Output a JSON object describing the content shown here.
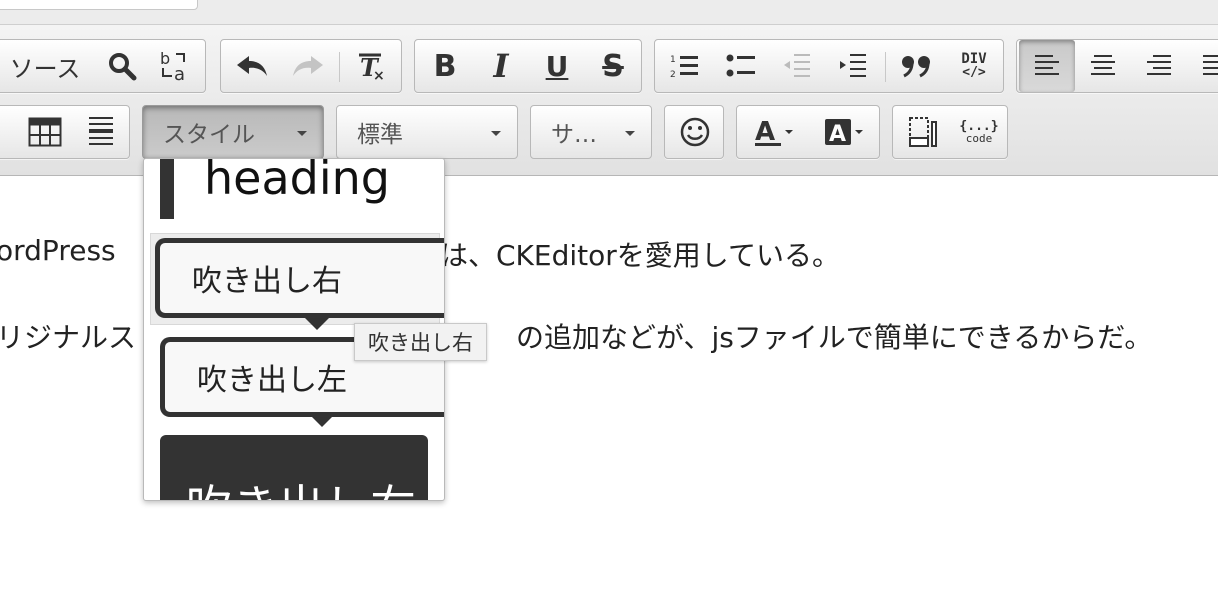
{
  "toolbar": {
    "row1": {
      "source_label": "ソース",
      "bold": "B",
      "italic": "I",
      "underline": "U",
      "strike": "S",
      "div_label": "DIV"
    },
    "row2": {
      "styles_combo": "スタイル",
      "format_combo": "標準",
      "size_combo": "サ…"
    },
    "icons": [
      "source-icon",
      "search-icon",
      "replace-icon",
      "undo-icon",
      "redo-icon",
      "remove-format-icon",
      "bold-icon",
      "italic-icon",
      "underline-icon",
      "strikethrough-icon",
      "numbered-list-icon",
      "bulleted-list-icon",
      "outdent-icon",
      "indent-icon",
      "blockquote-icon",
      "div-icon",
      "align-left-icon",
      "align-center-icon",
      "align-right-icon",
      "justify-icon",
      "table-icon",
      "horizontal-rule-icon",
      "smiley-icon",
      "text-color-icon",
      "background-color-icon",
      "preview-icon",
      "code-snippet-icon"
    ]
  },
  "editor": {
    "line1": "ordPress",
    "line1_tail": "は、CKEditorを愛用している。",
    "line2": "リジナルス",
    "line2_tail": "の追加などが、jsファイルで簡単にできるからだ。"
  },
  "styles_dropdown": {
    "items": [
      {
        "label": "heading",
        "kind": "heading"
      },
      {
        "label": "吹き出し右",
        "kind": "bubble-right"
      },
      {
        "label": "吹き出し左",
        "kind": "bubble-left"
      },
      {
        "label": "吹き出し右",
        "kind": "dark-block"
      }
    ],
    "tooltip": "吹き出し右"
  },
  "colors": {
    "toolbar_bg": "#e8e8e8",
    "dark": "#333333",
    "active": "#c9c9c9"
  }
}
